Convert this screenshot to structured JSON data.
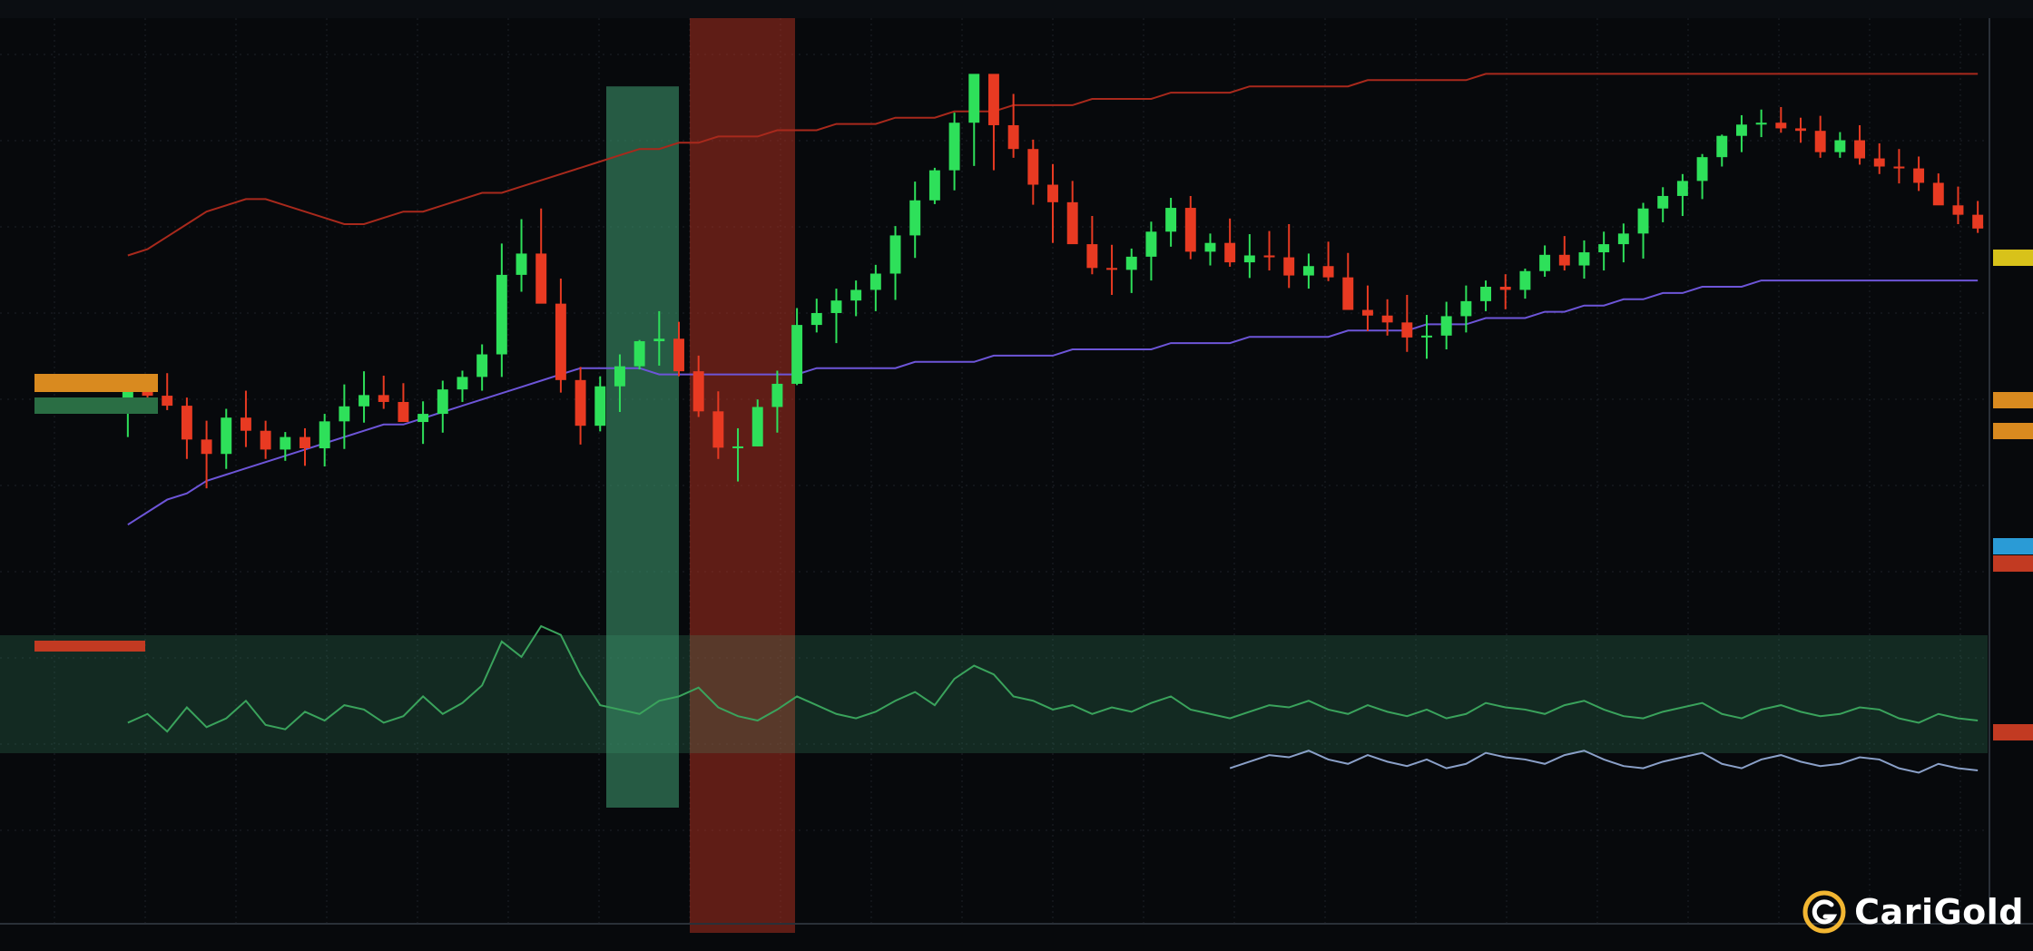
{
  "watermark": {
    "text": "CariGold",
    "logo": "carigold-logo"
  },
  "colors": {
    "background": "#07090c",
    "up": "#2ee05a",
    "down": "#e83a22",
    "ma_purple": "#6d55d8",
    "ma_dark_red": "#a8291c",
    "green_zone": "#3f9e73",
    "red_zone": "#b8321f",
    "volume_green": "#3aa35c",
    "volume_blue": "#8aa0c8",
    "grid": "#1c2128",
    "text_green": "#49c04c",
    "text_red": "#e84a2a",
    "text_gray": "#8a8f96",
    "tag_orange": "#d98a1f",
    "tag_green": "#2a6e44",
    "tag_red": "#c23a22",
    "tag_blue": "#2a9bd6",
    "tag_yellow": "#d8c21a"
  },
  "chart_data": {
    "type": "candlestick",
    "title": "",
    "xlabel": "",
    "ylabel": "",
    "ylim": [
      0,
      100
    ],
    "grid": true,
    "series": [
      {
        "kind": "ohlc",
        "values": [
          [
            40.0,
            45.3,
            36.0,
            43.3
          ],
          [
            43.3,
            45.5,
            39.8,
            42.6
          ],
          [
            42.6,
            46.2,
            40.3,
            41.0
          ],
          [
            41.0,
            42.3,
            32.5,
            35.6
          ],
          [
            35.6,
            38.6,
            27.8,
            33.3
          ],
          [
            33.3,
            40.5,
            30.9,
            39.1
          ],
          [
            39.1,
            43.4,
            34.4,
            37.0
          ],
          [
            37.0,
            38.6,
            32.5,
            34.0
          ],
          [
            34.0,
            36.8,
            32.2,
            36.0
          ],
          [
            36.0,
            37.4,
            31.4,
            34.2
          ],
          [
            34.2,
            39.7,
            31.3,
            38.5
          ],
          [
            38.5,
            44.4,
            34.1,
            40.9
          ],
          [
            40.9,
            46.5,
            38.3,
            42.7
          ],
          [
            42.7,
            45.8,
            40.5,
            41.6
          ],
          [
            41.6,
            44.6,
            39.6,
            38.4
          ],
          [
            38.4,
            41.7,
            34.9,
            39.7
          ],
          [
            39.7,
            45.0,
            36.7,
            43.6
          ],
          [
            43.6,
            46.6,
            41.6,
            45.6
          ],
          [
            45.6,
            50.8,
            43.4,
            49.2
          ],
          [
            49.2,
            66.9,
            45.6,
            61.9
          ],
          [
            61.9,
            70.8,
            59.2,
            65.3
          ],
          [
            65.3,
            72.5,
            61.2,
            57.3
          ],
          [
            57.3,
            61.3,
            43.1,
            45.1
          ],
          [
            45.1,
            47.2,
            34.8,
            37.8
          ],
          [
            37.8,
            45.7,
            36.9,
            44.1
          ],
          [
            44.1,
            49.2,
            40.0,
            47.3
          ],
          [
            47.3,
            51.5,
            46.8,
            51.3
          ],
          [
            51.3,
            56.1,
            47.4,
            51.7
          ],
          [
            51.7,
            54.4,
            45.7,
            46.5
          ],
          [
            46.5,
            49.0,
            39.2,
            40.1
          ],
          [
            40.1,
            43.3,
            32.5,
            34.3
          ],
          [
            34.3,
            37.4,
            28.9,
            34.5
          ],
          [
            34.5,
            42.0,
            34.5,
            40.8
          ],
          [
            40.8,
            46.6,
            36.7,
            44.5
          ],
          [
            44.5,
            56.6,
            44.3,
            53.9
          ],
          [
            53.9,
            58.1,
            52.7,
            55.8
          ],
          [
            55.8,
            59.7,
            51.0,
            57.8
          ],
          [
            57.8,
            61.0,
            55.3,
            59.5
          ],
          [
            59.5,
            63.5,
            56.1,
            62.1
          ],
          [
            62.1,
            69.7,
            57.9,
            68.2
          ],
          [
            68.2,
            76.8,
            64.6,
            73.8
          ],
          [
            73.8,
            79.0,
            73.2,
            78.6
          ],
          [
            78.6,
            87.8,
            75.4,
            86.2
          ],
          [
            86.2,
            91.4,
            79.3,
            94.0
          ],
          [
            94.0,
            90.0,
            78.6,
            85.8
          ],
          [
            85.8,
            90.8,
            80.6,
            82.0
          ],
          [
            82.0,
            83.5,
            73.1,
            76.3
          ],
          [
            76.3,
            79.6,
            67.0,
            73.5
          ],
          [
            73.5,
            76.9,
            69.4,
            66.8
          ],
          [
            66.8,
            71.3,
            62.0,
            63.0
          ],
          [
            63.0,
            66.7,
            58.7,
            62.7
          ],
          [
            62.7,
            66.1,
            59.0,
            64.8
          ],
          [
            64.8,
            70.4,
            61.0,
            68.8
          ],
          [
            68.8,
            74.2,
            66.4,
            72.6
          ],
          [
            72.6,
            74.5,
            64.4,
            65.6
          ],
          [
            65.6,
            68.5,
            63.4,
            67.0
          ],
          [
            67.0,
            70.9,
            63.2,
            63.9
          ],
          [
            63.9,
            68.4,
            61.4,
            65.0
          ],
          [
            65.0,
            68.9,
            62.6,
            64.7
          ],
          [
            64.7,
            70.0,
            59.8,
            61.8
          ],
          [
            61.8,
            65.3,
            59.7,
            63.3
          ],
          [
            63.3,
            67.2,
            60.9,
            61.5
          ],
          [
            61.5,
            65.4,
            57.5,
            56.3
          ],
          [
            56.3,
            60.2,
            52.9,
            55.4
          ],
          [
            55.4,
            58.0,
            52.2,
            54.3
          ],
          [
            54.3,
            58.7,
            49.6,
            51.9
          ],
          [
            51.9,
            55.5,
            48.5,
            52.2
          ],
          [
            52.2,
            57.6,
            50.0,
            55.3
          ],
          [
            55.3,
            60.2,
            52.7,
            57.7
          ],
          [
            57.7,
            61.0,
            56.1,
            60.0
          ],
          [
            60.0,
            62.0,
            56.4,
            59.5
          ],
          [
            59.5,
            62.9,
            58.1,
            62.5
          ],
          [
            62.5,
            66.6,
            61.6,
            65.1
          ],
          [
            65.1,
            68.1,
            62.6,
            63.4
          ],
          [
            63.4,
            67.4,
            61.3,
            65.5
          ],
          [
            65.5,
            68.8,
            62.6,
            66.8
          ],
          [
            66.8,
            70.1,
            63.9,
            68.5
          ],
          [
            68.5,
            73.4,
            64.5,
            72.5
          ],
          [
            72.5,
            75.9,
            70.3,
            74.5
          ],
          [
            74.5,
            78.0,
            71.3,
            76.9
          ],
          [
            76.9,
            81.2,
            74.0,
            80.7
          ],
          [
            80.7,
            84.3,
            79.2,
            84.1
          ],
          [
            84.1,
            87.4,
            81.5,
            85.9
          ],
          [
            85.9,
            88.3,
            83.9,
            86.2
          ],
          [
            86.2,
            88.7,
            84.6,
            85.3
          ],
          [
            85.3,
            87.0,
            83.0,
            84.9
          ],
          [
            84.9,
            87.3,
            80.6,
            81.5
          ],
          [
            81.5,
            84.7,
            80.6,
            83.4
          ],
          [
            83.4,
            85.8,
            79.5,
            80.5
          ],
          [
            80.5,
            82.9,
            78.0,
            79.2
          ],
          [
            79.2,
            82.0,
            76.5,
            78.9
          ],
          [
            78.9,
            80.8,
            75.3,
            76.6
          ],
          [
            76.6,
            78.1,
            73.3,
            73.0
          ],
          [
            73.0,
            76.0,
            70.0,
            71.5
          ],
          [
            71.5,
            73.7,
            68.6,
            69.3
          ]
        ]
      },
      {
        "name": "",
        "kind": "ma",
        "color": "ma_purple",
        "values": [
          22,
          24,
          26,
          27,
          29,
          30,
          31,
          32,
          33,
          34,
          35,
          36,
          37,
          38,
          38,
          39,
          40,
          41,
          42,
          43,
          44,
          45,
          46,
          47,
          47,
          47,
          47,
          46,
          46,
          46,
          46,
          46,
          46,
          46,
          46,
          47,
          47,
          47,
          47,
          47,
          48,
          48,
          48,
          48,
          49,
          49,
          49,
          49,
          50,
          50,
          50,
          50,
          50,
          51,
          51,
          51,
          51,
          52,
          52,
          52,
          52,
          52,
          53,
          53,
          53,
          53,
          54,
          54,
          54,
          55,
          55,
          55,
          56,
          56,
          57,
          57,
          58,
          58,
          59,
          59,
          60,
          60,
          60,
          61,
          61,
          61,
          61,
          61,
          61,
          61,
          61,
          61,
          61,
          61,
          61
        ]
      },
      {
        "name": "",
        "kind": "ma",
        "color": "ma_dark_red",
        "values": [
          65,
          66,
          68,
          70,
          72,
          73,
          74,
          74,
          73,
          72,
          71,
          70,
          70,
          71,
          72,
          72,
          73,
          74,
          75,
          75,
          76,
          77,
          78,
          79,
          80,
          81,
          82,
          82,
          83,
          83,
          84,
          84,
          84,
          85,
          85,
          85,
          86,
          86,
          86,
          87,
          87,
          87,
          88,
          88,
          88,
          89,
          89,
          89,
          89,
          90,
          90,
          90,
          90,
          91,
          91,
          91,
          91,
          92,
          92,
          92,
          92,
          92,
          92,
          93,
          93,
          93,
          93,
          93,
          93,
          94,
          94,
          94,
          94,
          94,
          94,
          94,
          94,
          94,
          94,
          94,
          94,
          94,
          94,
          94,
          94,
          94,
          94,
          94,
          94,
          94,
          94,
          94,
          94,
          94,
          94
        ]
      }
    ],
    "volume": [
      18,
      22,
      14,
      25,
      16,
      20,
      28,
      17,
      15,
      23,
      19,
      26,
      24,
      18,
      21,
      30,
      22,
      27,
      35,
      55,
      48,
      62,
      58,
      40,
      26,
      24,
      22,
      28,
      30,
      34,
      25,
      21,
      19,
      24,
      30,
      26,
      22,
      20,
      23,
      28,
      32,
      26,
      38,
      44,
      40,
      30,
      28,
      24,
      26,
      22,
      25,
      23,
      27,
      30,
      24,
      22,
      20,
      23,
      26,
      25,
      28,
      24,
      22,
      26,
      23,
      21,
      24,
      20,
      22,
      27,
      25,
      24,
      22,
      26,
      28,
      24,
      21,
      20,
      23,
      25,
      27,
      22,
      20,
      24,
      26,
      23,
      21,
      22,
      25,
      24,
      20,
      18,
      22,
      20,
      19
    ]
  }
}
